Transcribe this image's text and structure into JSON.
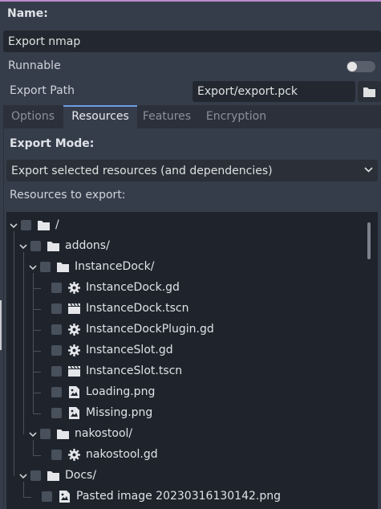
{
  "form": {
    "name_label": "Name:",
    "name_value": "Export nmap",
    "runnable_label": "Runnable",
    "runnable_on": false,
    "export_path_label": "Export Path",
    "export_path_value": "Export/export.pck"
  },
  "tabs": [
    {
      "label": "Options",
      "active": false
    },
    {
      "label": "Resources",
      "active": true
    },
    {
      "label": "Features",
      "active": false
    },
    {
      "label": "Encryption",
      "active": false
    }
  ],
  "resources": {
    "export_mode_label": "Export Mode:",
    "export_mode_value": "Export selected resources (and dependencies)",
    "resources_to_export_label": "Resources to export:"
  },
  "tree": [
    {
      "label": "/",
      "type": "folder",
      "depth": 0,
      "expanded": true
    },
    {
      "label": "addons/",
      "type": "folder",
      "depth": 1,
      "expanded": true
    },
    {
      "label": "InstanceDock/",
      "type": "folder",
      "depth": 2,
      "expanded": true
    },
    {
      "label": "InstanceDock.gd",
      "type": "script",
      "depth": 3
    },
    {
      "label": "InstanceDock.tscn",
      "type": "scene",
      "depth": 3
    },
    {
      "label": "InstanceDockPlugin.gd",
      "type": "script",
      "depth": 3
    },
    {
      "label": "InstanceSlot.gd",
      "type": "script",
      "depth": 3
    },
    {
      "label": "InstanceSlot.tscn",
      "type": "scene",
      "depth": 3
    },
    {
      "label": "Loading.png",
      "type": "image",
      "depth": 3
    },
    {
      "label": "Missing.png",
      "type": "image",
      "depth": 3
    },
    {
      "label": "nakostool/",
      "type": "folder",
      "depth": 2,
      "expanded": true
    },
    {
      "label": "nakostool.gd",
      "type": "script",
      "depth": 3
    },
    {
      "label": "Docs/",
      "type": "folder",
      "depth": 1,
      "expanded": true
    },
    {
      "label": "Pasted image 20230316130142.png",
      "type": "image",
      "depth": 2
    }
  ],
  "icons": {
    "folder": "folder-icon",
    "script": "gear-icon",
    "scene": "clapperboard-icon",
    "image": "image-file-icon",
    "browse": "folder-browse-icon",
    "expand": "chevron-down-icon"
  },
  "colors": {
    "accent": "#6c9ce6",
    "top_line": "#b98acb",
    "panel_bg": "#363d4a",
    "tree_bg": "#1f242c"
  }
}
